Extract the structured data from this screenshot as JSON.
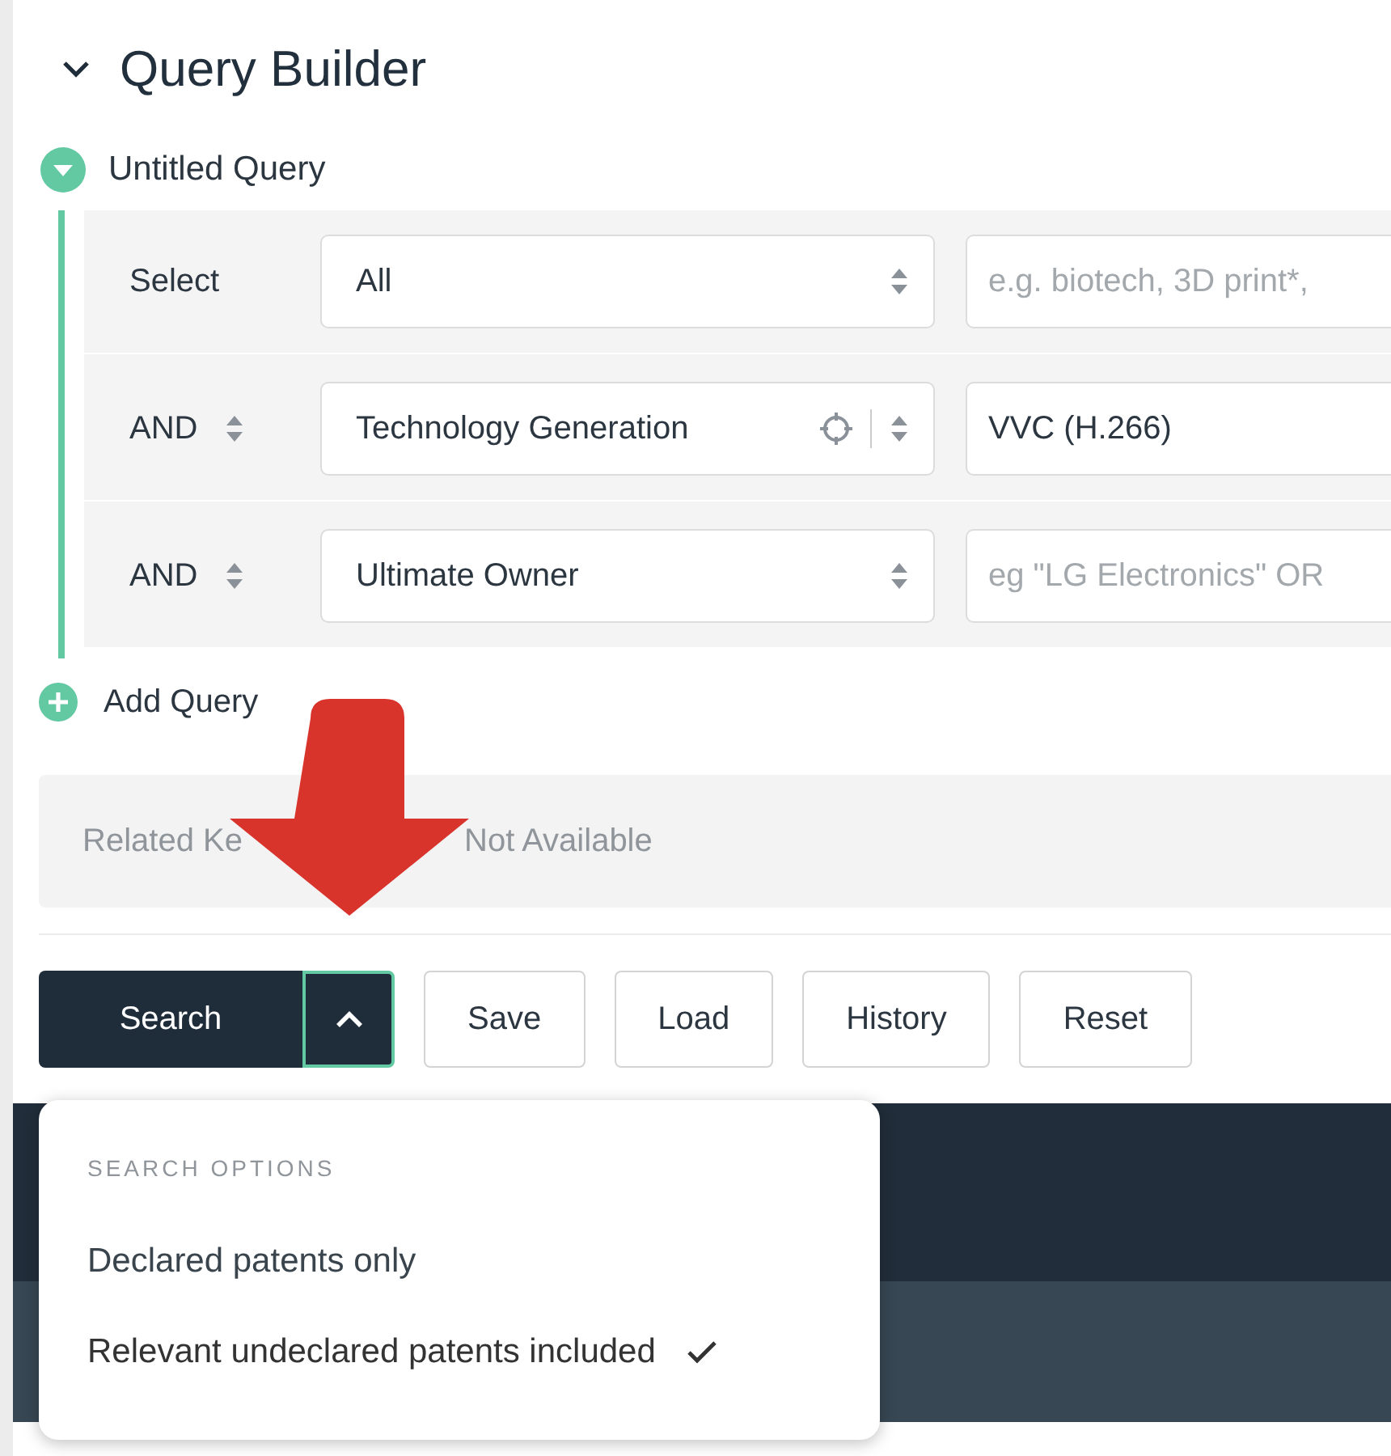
{
  "panel": {
    "title": "Query Builder",
    "expanded": true
  },
  "query": {
    "title": "Untitled Query",
    "expanded": true,
    "rows": [
      {
        "kind": "select",
        "connector": "Select",
        "field": "All",
        "has_target": false,
        "placeholder": "e.g. biotech, 3D print*,"
      },
      {
        "kind": "and",
        "connector": "AND",
        "field": "Technology Generation",
        "has_target": true,
        "value": "VVC (H.266)"
      },
      {
        "kind": "and",
        "connector": "AND",
        "field": "Ultimate Owner",
        "has_target": false,
        "placeholder": "eg \"LG Electronics\" OR"
      }
    ]
  },
  "add_query": "Add Query",
  "related": {
    "label": "Related Ke",
    "value": "Not Available"
  },
  "buttons": {
    "search": "Search",
    "menu_open": true,
    "others": [
      "Save",
      "Load",
      "History",
      "Reset"
    ]
  },
  "search_options": {
    "heading": "SEARCH OPTIONS",
    "items": [
      {
        "label": "Declared patents only",
        "selected": false
      },
      {
        "label": "Relevant undeclared patents included",
        "selected": true
      }
    ]
  }
}
